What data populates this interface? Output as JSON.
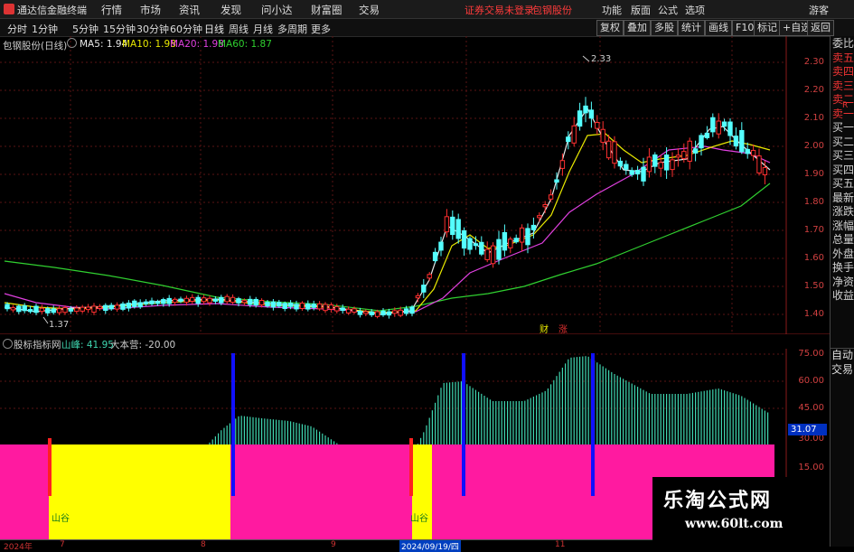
{
  "app": {
    "name": "通达信金融终端"
  },
  "menu": [
    "行情",
    "市场",
    "资讯",
    "发现",
    "问小达",
    "财富圈",
    "交易"
  ],
  "warning": "证券交易未登录",
  "stock_title": "包钢股份",
  "right_menu": [
    "功能",
    "版面",
    "公式",
    "选项",
    "游客"
  ],
  "periods": [
    "分时",
    "1分钟",
    "5分钟",
    "15分钟",
    "30分钟",
    "60分钟",
    "日线",
    "周线",
    "月线",
    "多周期",
    "更多"
  ],
  "toolbar_buttons": [
    "复权",
    "叠加",
    "多股",
    "统计",
    "画线",
    "F10",
    "标记",
    "+自选",
    "返回"
  ],
  "main_chart": {
    "label": "包钢股份(日线)",
    "ma": [
      {
        "name": "MA5",
        "value": "1.94",
        "color": "#e8e8e8"
      },
      {
        "name": "MA10",
        "value": "1.98",
        "color": "#e8e800"
      },
      {
        "name": "MA20",
        "value": "1.98",
        "color": "#e040e0"
      },
      {
        "name": "MA60",
        "value": "1.87",
        "color": "#30d030"
      }
    ],
    "high_label": "2.33",
    "low_label": "1.37",
    "marks": [
      "财",
      "涨"
    ],
    "yticks": [
      "2.30",
      "2.20",
      "2.10",
      "2.00",
      "1.90",
      "1.80",
      "1.70",
      "1.60",
      "1.50",
      "1.40"
    ]
  },
  "indicator": {
    "label": "股标指标网",
    "value_text": "山峰: 41.95",
    "value2_text": "大本营: -20.00",
    "yticks": [
      "75.00",
      "60.00",
      "45.00",
      "30.00",
      "15.00"
    ],
    "current": "31.07",
    "valley_labels": [
      "山谷",
      "山谷"
    ]
  },
  "side_panel": [
    "委比",
    "卖五",
    "卖四",
    "卖三",
    "卖二",
    "卖一",
    "买一",
    "买二",
    "买三",
    "买四",
    "买五",
    "最新",
    "涨跌",
    "涨幅",
    "总量",
    "外盘",
    "换手",
    "净资",
    "收益"
  ],
  "side_panel2": [
    "自动",
    "交易"
  ],
  "dates": [
    "2024年",
    "7",
    "8",
    "9",
    "2024/09/19/四",
    "11"
  ],
  "watermark": {
    "line1": "乐淘公式网",
    "line2": "www.60lt.com"
  },
  "colors": {
    "up": "#ff3030",
    "down": "#54ffff",
    "pink": "#ff1aa0",
    "yellow": "#ffff00",
    "blue": "#1010ff",
    "teal": "#3fd6b0"
  }
}
